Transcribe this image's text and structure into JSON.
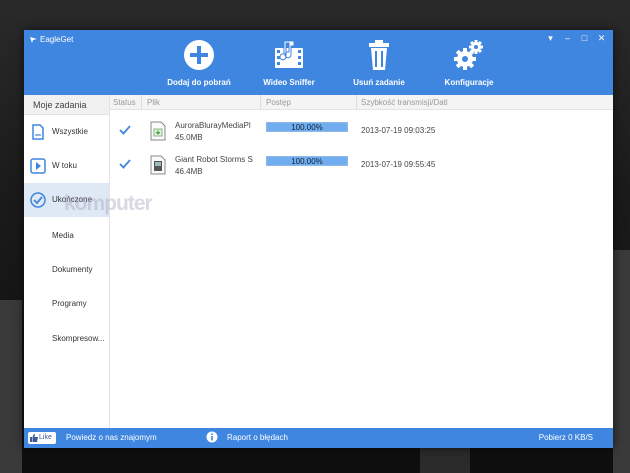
{
  "app": {
    "title": "EagleGet"
  },
  "window_controls": {
    "menu": "▾",
    "minimize": "–",
    "maximize": "□",
    "close": "✕"
  },
  "toolbar": {
    "items": [
      {
        "label": "Dodaj do pobrań",
        "icon": "add-icon"
      },
      {
        "label": "Wideo Sniffer",
        "icon": "video-sniffer-icon"
      },
      {
        "label": "Usuń zadanie",
        "icon": "trash-icon"
      },
      {
        "label": "Konfiguracje",
        "icon": "gears-icon"
      }
    ]
  },
  "sidebar": {
    "header": "Moje zadania",
    "items": [
      {
        "label": "Wszystkie",
        "icon": "document-icon"
      },
      {
        "label": "W toku",
        "icon": "play-icon"
      },
      {
        "label": "Ukończone",
        "icon": "check-circle-icon"
      }
    ],
    "categories": [
      {
        "label": "Media"
      },
      {
        "label": "Dokumenty"
      },
      {
        "label": "Programy"
      },
      {
        "label": "Skompresow..."
      }
    ]
  },
  "columns": {
    "status": "Status",
    "file": "Plik",
    "progress": "Postęp",
    "speed_date": "Szybkość transmisji/Dati"
  },
  "downloads": [
    {
      "name": "AuroraBlurayMediaPl",
      "size": "45.0MB",
      "progress_text": "100.00%",
      "progress": 1.0,
      "date": "2013-07-19 09:03:25",
      "file_icon": "installer-file-icon"
    },
    {
      "name": "Giant Robot Storms S",
      "size": "46.4MB",
      "progress_text": "100.00%",
      "progress": 1.0,
      "date": "2013-07-19 09:55:45",
      "file_icon": "video-file-icon"
    }
  ],
  "statusbar": {
    "like": "Like",
    "recommend": "Powiedz o nas znajomym",
    "report": "Raport o błędach",
    "speed": "Pobierz   0 KB/S"
  },
  "watermark": "komputer",
  "colors": {
    "accent": "#3f86e0",
    "progress": "#71aef0",
    "check": "#3f86e0"
  }
}
